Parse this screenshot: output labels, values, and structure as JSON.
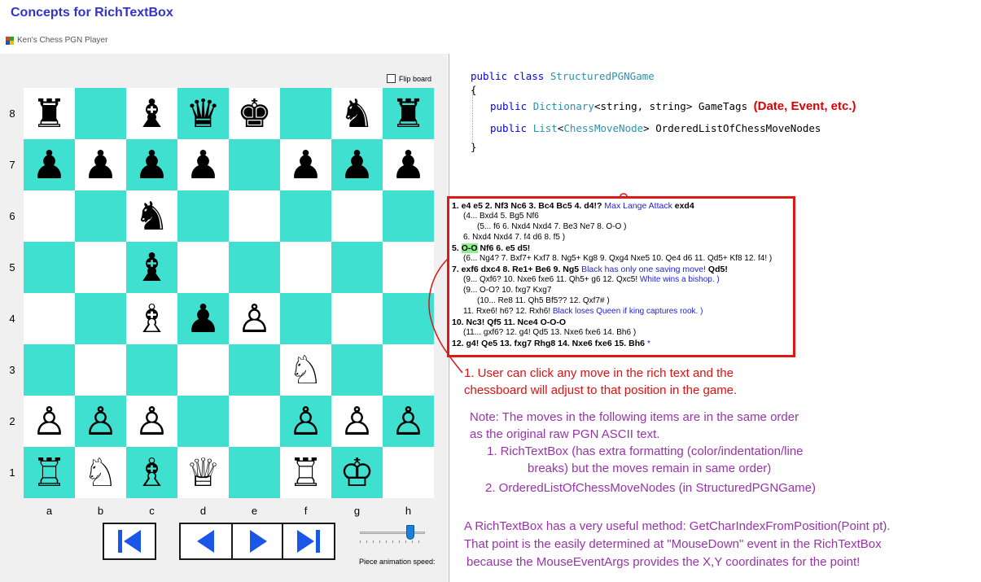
{
  "page_title": "Concepts for RichTextBox",
  "window": {
    "title": "Ken's Chess PGN Player",
    "flip_board_label": "Flip board",
    "flip_board_checked": false,
    "speed_label": "Piece animation speed:",
    "speed_value": 0.75
  },
  "board": {
    "files": [
      "a",
      "b",
      "c",
      "d",
      "e",
      "f",
      "g",
      "h"
    ],
    "ranks": [
      "8",
      "7",
      "6",
      "5",
      "4",
      "3",
      "2",
      "1"
    ],
    "light_color": "#ffffff",
    "dark_color": "#40e0d0",
    "rows": [
      [
        "♜",
        "",
        "♝",
        "♛",
        "♚",
        "",
        "♞",
        "♜"
      ],
      [
        "♟",
        "♟",
        "♟",
        "♟",
        "",
        "♟",
        "♟",
        "♟"
      ],
      [
        "",
        "",
        "♞",
        "",
        "",
        "",
        "",
        ""
      ],
      [
        "",
        "",
        "♝",
        "",
        "",
        "",
        "",
        ""
      ],
      [
        "",
        "",
        "♗",
        "♟",
        "♙",
        "",
        "",
        ""
      ],
      [
        "",
        "",
        "",
        "",
        "",
        "♘",
        "",
        ""
      ],
      [
        "♙",
        "♙",
        "♙",
        "",
        "",
        "♙",
        "♙",
        "♙"
      ],
      [
        "♖",
        "♘",
        "♗",
        "♕",
        "",
        "♖",
        "♔",
        ""
      ]
    ]
  },
  "nav_buttons": [
    {
      "name": "first-move-button",
      "icon": "skip-to-start-icon"
    },
    {
      "name": "previous-move-button",
      "icon": "step-back-icon"
    },
    {
      "name": "next-move-button",
      "icon": "step-forward-icon"
    },
    {
      "name": "last-move-button",
      "icon": "skip-to-end-icon"
    }
  ],
  "code": {
    "line1_kw": "public class ",
    "line1_type": "StructuredPGNGame",
    "brace_open": "{",
    "line2_kw": "public ",
    "line2_type": "Dictionary",
    "line2_rest": "<string, string> GameTags ",
    "line2_note": "(Date, Event, etc.)",
    "line3_kw": "public ",
    "line3_type": "List",
    "line3_lt": "<",
    "line3_type2": "ChessMoveNode",
    "line3_rest": "> OrderedListOfChessMoveNodes",
    "brace_close": "}"
  },
  "rtb": {
    "l1_moves": "1. e4  e5  2. Nf3  Nc6  3. Bc4  Bc5  4. d4!? ",
    "l1_comment": "Max Lange Attack ",
    "l1_tail": " exd4",
    "l2": "(4... Bxd4  5. Bg5  Nf6",
    "l3": "(5... f6  6. Nxd4  Nxd4  7. Be3  Ne7  8. O-O )",
    "l4": "6. Nxd4  Nxd4  7. f4  d6  8. f5 )",
    "l5_num": "5. ",
    "l5_hl": "O-O",
    "l5_rest": "  Nf6  6. e5  d5!",
    "l6": "(6... Ng4?  7. Bxf7+  Kxf7  8. Ng5+  Kg8  9. Qxg4  Nxe5  10. Qe4  d6  11. Qd5+  Kf8  12. f4! )",
    "l7_moves": "7. exf6  dxc4  8. Re1+  Be6  9. Ng5 ",
    "l7_comment": "Black has only  one saving move! ",
    "l7_tail": " Qd5!",
    "l8_moves": "(9... Qxf6?  10. Nxe6  fxe6  11. Qh5+  g6  12. Qxc5! ",
    "l8_comment": "White wins a bishop.",
    "l8_tail": "  )",
    "l9": "(9... O-O?  10. fxg7  Kxg7",
    "l10": "(10... Re8  11. Qh5  Bf5??  12. Qxf7# )",
    "l11_moves": "11. Rxe6!  h6?  12. Rxh6! ",
    "l11_comment": "Black loses Queen if king captures  rook.",
    "l11_tail": "  )",
    "l12": "10. Nc3!  Qf5  11. Nce4  O-O-O",
    "l13": "(11... gxf6?  12. g4!  Qd5  13. Nxe6  fxe6  14. Bh6 )",
    "l14": "12. g4!  Qe5  13. fxg7  Rhg8  14. Nxe6  fxe6  15. Bh6",
    "l14_tail": "  *"
  },
  "annotation_red": {
    "line1": "1. User can click any move in the rich text and the",
    "line2": "chessboard will adjust to that position in the game."
  },
  "note": {
    "line1": "Note: The moves in the following items are in the same order",
    "line2": "as the original raw PGN ASCII text.",
    "item1_line1": "1.  RichTextBox (has extra formatting (color/indentation/line",
    "item1_line2": "breaks) but the moves remain in same order)",
    "item2": "2. OrderedListOfChessMoveNodes (in StructuredPGNGame)"
  },
  "bottom": {
    "line1": "A RichTextBox has a very useful method: GetCharIndexFromPosition(Point pt).",
    "line2": "That point is the easily determined at \"MouseDown\" event in the RichTextBox",
    "line3": "because the MouseEventArgs provides the X,Y coordinates for the point!"
  },
  "colors": {
    "title_blue": "#3333cc",
    "annotation_red": "#dd1111",
    "note_purple": "#9933aa",
    "comment_blue": "#2222dd",
    "move_highlight": "#90ee90"
  }
}
